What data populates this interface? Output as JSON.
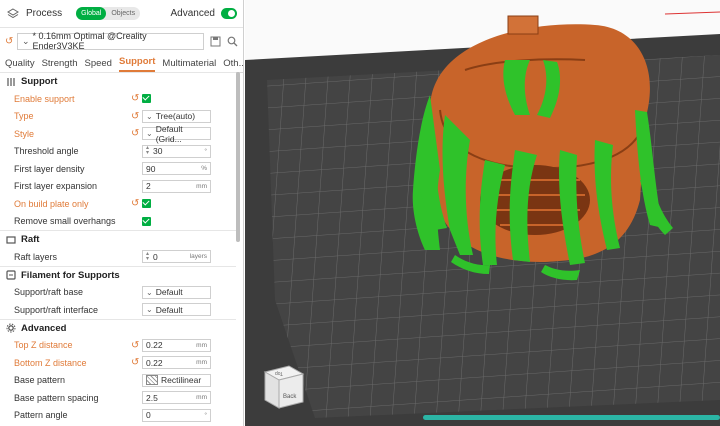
{
  "topbar": {
    "title": "Process",
    "toggle_global": "Global",
    "toggle_objects": "Objects",
    "advanced_label": "Advanced",
    "advanced_on": true
  },
  "preset": {
    "name": "* 0.16mm Optimal @Creality Ender3V3KE"
  },
  "tabs": [
    "Quality",
    "Strength",
    "Speed",
    "Support",
    "Multimaterial",
    "Oth..."
  ],
  "active_tab": "Support",
  "sections": {
    "support": {
      "title": "Support",
      "enable_support": {
        "label": "Enable support",
        "checked": true
      },
      "type": {
        "label": "Type",
        "value": "Tree(auto)"
      },
      "style": {
        "label": "Style",
        "value": "Default (Grid..."
      },
      "threshold_angle": {
        "label": "Threshold angle",
        "value": "30",
        "unit": "°"
      },
      "first_layer_density": {
        "label": "First layer density",
        "value": "90",
        "unit": "%"
      },
      "first_layer_expansion": {
        "label": "First layer expansion",
        "value": "2",
        "unit": "mm"
      },
      "on_build_plate_only": {
        "label": "On build plate only",
        "checked": true
      },
      "remove_small_overhangs": {
        "label": "Remove small overhangs",
        "checked": true
      }
    },
    "raft": {
      "title": "Raft",
      "raft_layers": {
        "label": "Raft layers",
        "value": "0",
        "unit": "layers"
      }
    },
    "filament": {
      "title": "Filament for Supports",
      "support_raft_base": {
        "label": "Support/raft base",
        "value": "Default"
      },
      "support_raft_interface": {
        "label": "Support/raft interface",
        "value": "Default"
      }
    },
    "advanced": {
      "title": "Advanced",
      "top_z_distance": {
        "label": "Top Z distance",
        "value": "0.22",
        "unit": "mm"
      },
      "bottom_z_distance": {
        "label": "Bottom Z distance",
        "value": "0.22",
        "unit": "mm"
      },
      "base_pattern": {
        "label": "Base pattern",
        "value": "Rectilinear"
      },
      "base_pattern_spacing": {
        "label": "Base pattern spacing",
        "value": "2.5",
        "unit": "mm"
      },
      "pattern_angle": {
        "label": "Pattern angle",
        "value": "0",
        "unit": "°"
      }
    }
  },
  "view": {
    "cube_top": "Top",
    "cube_back": "Back"
  },
  "colors": {
    "accent": "#00ae42",
    "modified": "#e07b39",
    "model": "#c8642a",
    "support": "#2fc22a",
    "plate": "#474747"
  },
  "icons": {
    "reset": "reset-arrow-icon",
    "save": "save-icon",
    "search": "search-icon",
    "layers": "layers-icon"
  }
}
